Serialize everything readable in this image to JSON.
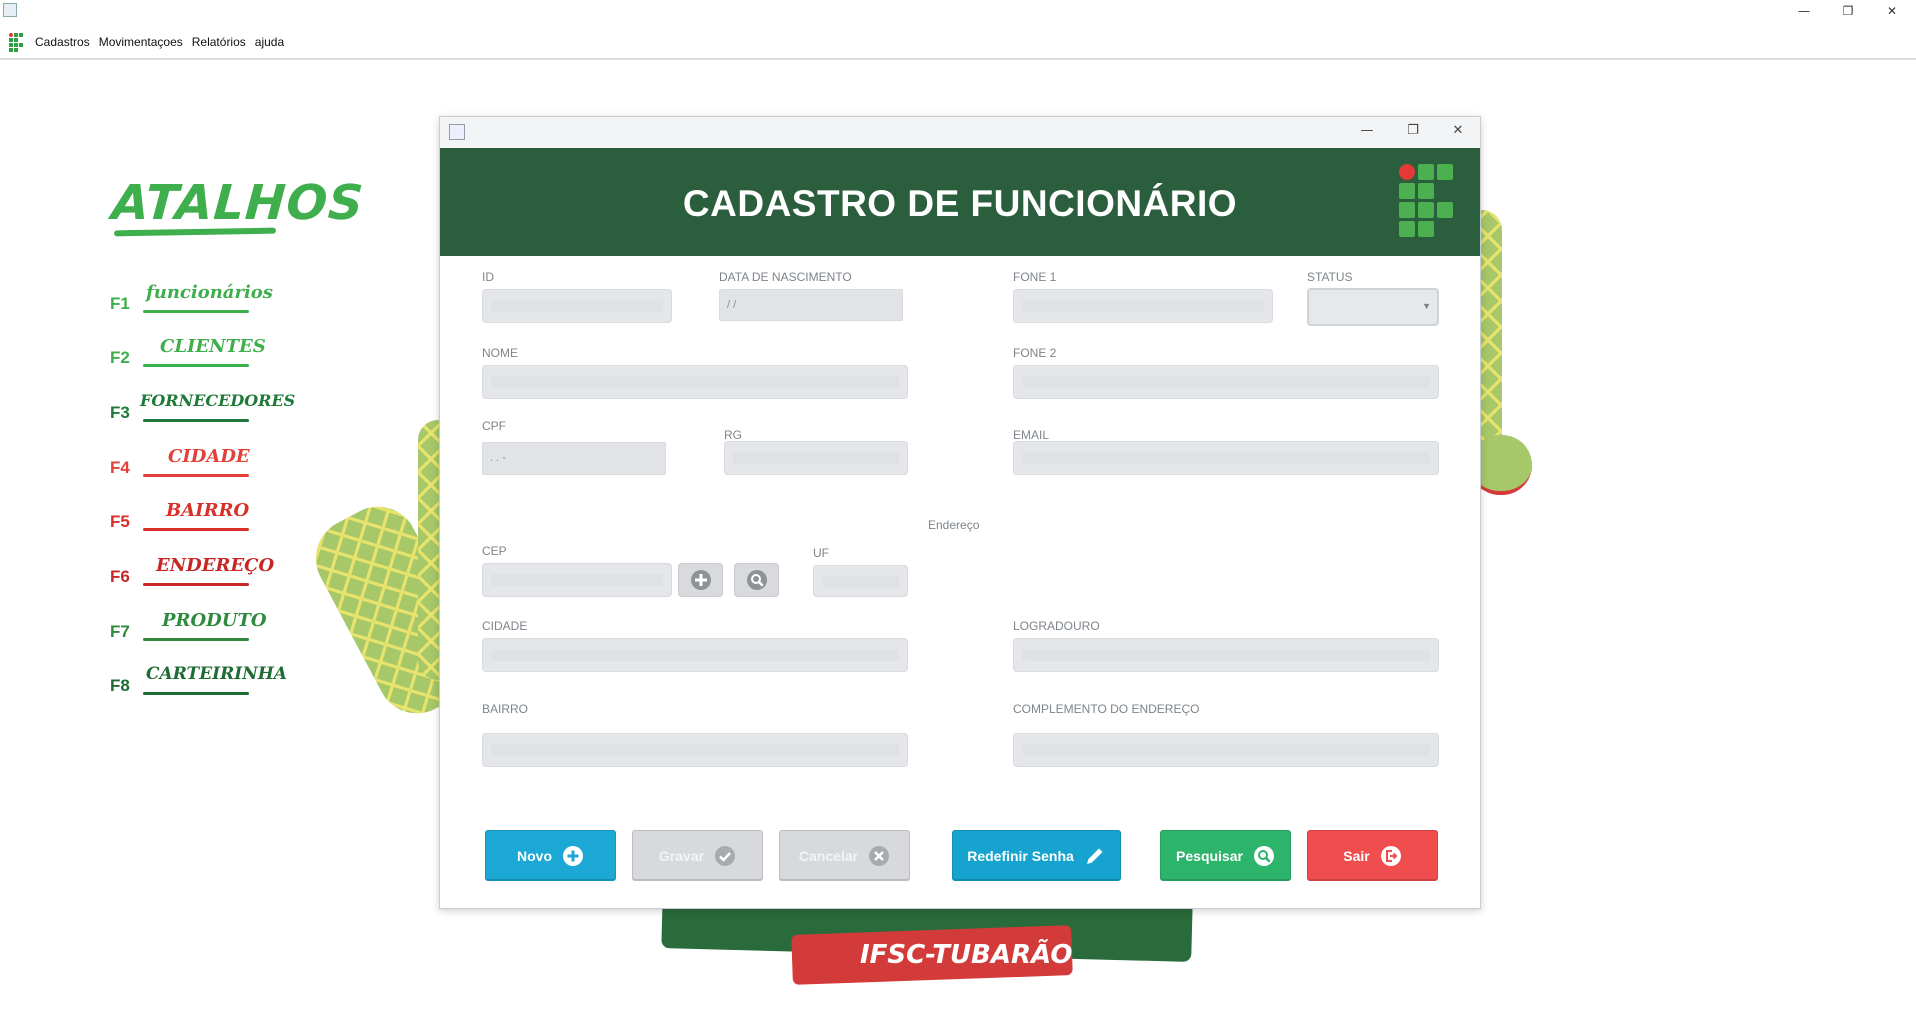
{
  "window": {
    "minimize_glyph": "—",
    "restore_glyph": "❐",
    "close_glyph": "✕"
  },
  "menu": {
    "items": [
      "Cadastros",
      "Movimentaçoes",
      "Relatórios",
      "ajuda"
    ]
  },
  "shortcuts": {
    "title": "ATALHOS",
    "items": [
      {
        "key": "F1",
        "label": "funcionários",
        "color": "#3fae4d"
      },
      {
        "key": "F2",
        "label": "CLIENTES",
        "color": "#3fae4d"
      },
      {
        "key": "F3",
        "label": "FORNECEDORES",
        "color": "#1f7a3a"
      },
      {
        "key": "F4",
        "label": "CIDADE",
        "color": "#e2403a"
      },
      {
        "key": "F5",
        "label": "BAIRRO",
        "color": "#d9302a"
      },
      {
        "key": "F6",
        "label": "ENDEREÇO",
        "color": "#c62828"
      },
      {
        "key": "F7",
        "label": "PRODUTO",
        "color": "#2e8b3e"
      },
      {
        "key": "F8",
        "label": "CARTEIRINHA",
        "color": "#1e6b34"
      }
    ]
  },
  "background": {
    "bottom_text": "IFSC-TUBARÃO"
  },
  "dialog": {
    "title": "CADASTRO DE FUNCIONÁRIO",
    "labels": {
      "id": "ID",
      "birth_date": "DATA DE NASCIMENTO",
      "phone1": "FONE 1",
      "status": "STATUS",
      "name": "NOME",
      "phone2": "FONE 2",
      "cpf": "CPF",
      "rg": "RG",
      "email": "EMAIL",
      "address_section": "Endereço",
      "cep": "CEP",
      "uf": "UF",
      "city": "CIDADE",
      "street": "LOGRADOURO",
      "neighborhood": "BAIRRO",
      "complement": "COMPLEMENTO DO ENDEREÇO"
    },
    "masks": {
      "birth_date": "/ /",
      "cpf": ".  .  -"
    },
    "buttons": {
      "new": "Novo",
      "save": "Gravar",
      "cancel": "Cancelar",
      "reset_password": "Redefinir Senha",
      "search": "Pesquisar",
      "exit": "Sair"
    },
    "colors": {
      "header": "#2a5e3c",
      "new": "#1ba8d4",
      "reset_password": "#16a3cf",
      "search": "#2db46b",
      "exit": "#f04e4e"
    }
  }
}
